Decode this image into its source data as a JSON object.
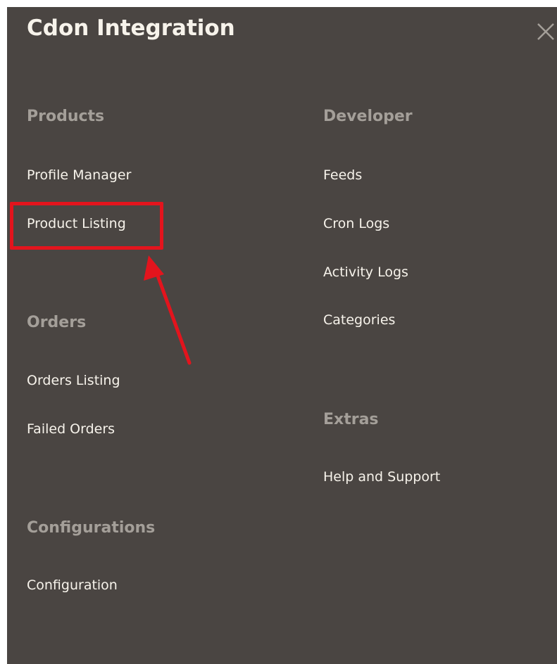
{
  "header": {
    "title": "Cdon Integration",
    "close_icon": "close-icon"
  },
  "columns": {
    "left": {
      "sections": [
        {
          "heading": "Products",
          "items": [
            "Profile Manager",
            "Product Listing"
          ]
        },
        {
          "heading": "Orders",
          "items": [
            "Orders Listing",
            "Failed Orders"
          ]
        },
        {
          "heading": "Configurations",
          "items": [
            "Configuration"
          ]
        }
      ]
    },
    "right": {
      "sections": [
        {
          "heading": "Developer",
          "items": [
            "Feeds",
            "Cron Logs",
            "Activity Logs",
            "Categories"
          ]
        },
        {
          "heading": "Extras",
          "items": [
            "Help and Support"
          ]
        }
      ]
    }
  },
  "annotation": {
    "highlighted_item": "Product Listing",
    "color": "#e3141d"
  },
  "colors": {
    "panel_background": "#4a4542",
    "heading_text": "#a49f99",
    "item_text": "#f7f3eb"
  }
}
